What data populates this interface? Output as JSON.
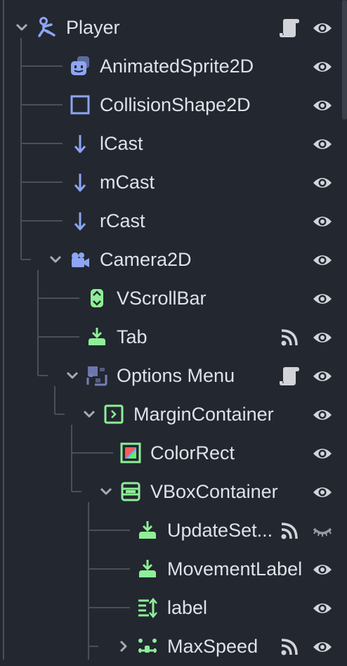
{
  "scene_tree": {
    "nodes": [
      {
        "label": "Player",
        "depth": 0,
        "type": "node2d",
        "expander": "down",
        "script": true,
        "signal": false,
        "visibility": "visible"
      },
      {
        "label": "AnimatedSprite2D",
        "depth": 1,
        "type": "animated-sprite",
        "expander": "none",
        "script": false,
        "signal": false,
        "visibility": "visible"
      },
      {
        "label": "CollisionShape2D",
        "depth": 1,
        "type": "collision-shape",
        "expander": "none",
        "script": false,
        "signal": false,
        "visibility": "visible"
      },
      {
        "label": "lCast",
        "depth": 1,
        "type": "raycast",
        "expander": "none",
        "script": false,
        "signal": false,
        "visibility": "visible"
      },
      {
        "label": "mCast",
        "depth": 1,
        "type": "raycast",
        "expander": "none",
        "script": false,
        "signal": false,
        "visibility": "visible"
      },
      {
        "label": "rCast",
        "depth": 1,
        "type": "raycast",
        "expander": "none",
        "script": false,
        "signal": false,
        "visibility": "visible"
      },
      {
        "label": "Camera2D",
        "depth": 1,
        "type": "camera",
        "expander": "down",
        "script": false,
        "signal": false,
        "visibility": "visible"
      },
      {
        "label": "VScrollBar",
        "depth": 2,
        "type": "vscrollbar",
        "expander": "none",
        "script": false,
        "signal": false,
        "visibility": "visible"
      },
      {
        "label": "Tab",
        "depth": 2,
        "type": "label",
        "expander": "none",
        "script": false,
        "signal": true,
        "visibility": "visible"
      },
      {
        "label": "Options Menu",
        "depth": 2,
        "type": "control",
        "expander": "down",
        "script": true,
        "signal": false,
        "visibility": "visible"
      },
      {
        "label": "MarginContainer",
        "depth": 3,
        "type": "margin-container",
        "expander": "down",
        "script": false,
        "signal": false,
        "visibility": "visible"
      },
      {
        "label": "ColorRect",
        "depth": 4,
        "type": "color-rect",
        "expander": "none",
        "script": false,
        "signal": false,
        "visibility": "visible"
      },
      {
        "label": "VBoxContainer",
        "depth": 4,
        "type": "vbox-container",
        "expander": "down",
        "script": false,
        "signal": false,
        "visibility": "visible"
      },
      {
        "label": "UpdateSet...",
        "depth": 5,
        "type": "label",
        "expander": "none",
        "script": false,
        "signal": true,
        "visibility": "hidden"
      },
      {
        "label": "MovementLabel",
        "depth": 5,
        "type": "label",
        "expander": "none",
        "script": false,
        "signal": false,
        "visibility": "visible"
      },
      {
        "label": "label",
        "depth": 5,
        "type": "rich-text-label",
        "expander": "none",
        "script": false,
        "signal": false,
        "visibility": "visible"
      },
      {
        "label": "MaxSpeed",
        "depth": 5,
        "type": "hslider",
        "expander": "right",
        "script": false,
        "signal": true,
        "visibility": "visible"
      }
    ]
  },
  "colors": {
    "background": "#232730",
    "text": "#dfe2e7",
    "node2d_blue": "#8da5f3",
    "control_green": "#8eef97",
    "icon_gray": "#d2d4d8",
    "guide_line": "#4a4f58",
    "expander": "#a7abb2"
  }
}
